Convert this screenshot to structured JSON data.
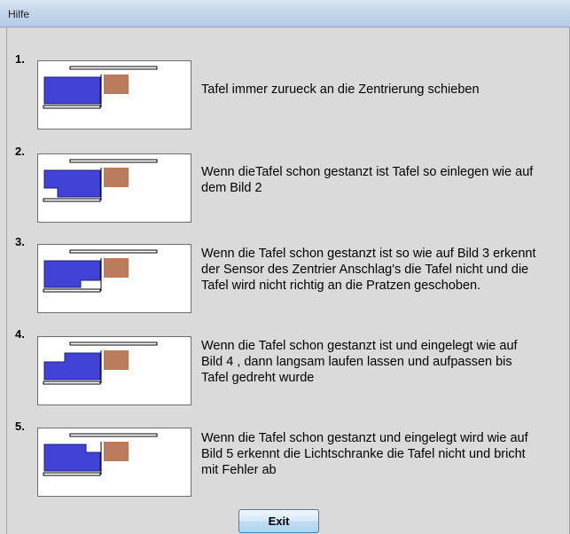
{
  "window": {
    "title": "Hilfe"
  },
  "steps": [
    {
      "number": "1.",
      "text": "Tafel immer zurueck an die Zentrierung schieben"
    },
    {
      "number": "2.",
      "text": "Wenn dieTafel schon gestanzt ist Tafel so einlegen wie auf dem Bild 2"
    },
    {
      "number": "3.",
      "text": "Wenn die Tafel schon gestanzt ist so wie auf Bild 3 erkennt der Sensor des Zentrier Anschlag's die Tafel nicht und die Tafel wird nicht richtig an die Pratzen geschoben."
    },
    {
      "number": "4.",
      "text": "Wenn die Tafel schon gestanzt ist und eingelegt wie auf Bild 4 , dann langsam laufen lassen und aufpassen bis Tafel gedreht wurde"
    },
    {
      "number": "5.",
      "text": "Wenn die Tafel schon gestanzt und eingelegt wird wie auf Bild 5 erkennt die Lichtschranke die Tafel nicht und bricht mit Fehler ab"
    }
  ],
  "buttons": {
    "exit_label": "Exit"
  },
  "colors": {
    "panel_blue": "#4043d6",
    "sensor_brown": "#bb7c5d"
  }
}
